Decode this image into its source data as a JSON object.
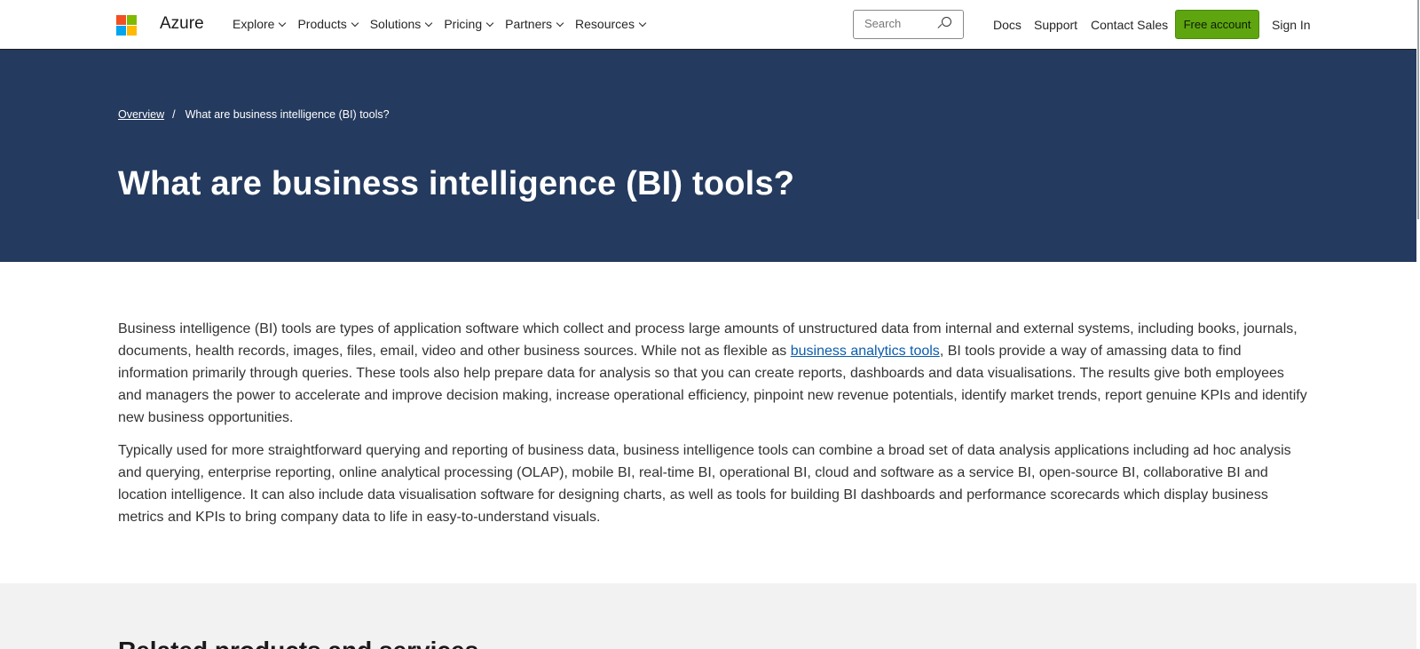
{
  "header": {
    "brand": "Azure",
    "logo_colors": [
      "#f25022",
      "#7fba00",
      "#00a4ef",
      "#ffb900"
    ],
    "nav": [
      {
        "label": "Explore"
      },
      {
        "label": "Products"
      },
      {
        "label": "Solutions"
      },
      {
        "label": "Pricing"
      },
      {
        "label": "Partners"
      },
      {
        "label": "Resources"
      }
    ],
    "search_placeholder": "Search",
    "docs": "Docs",
    "support": "Support",
    "contact_sales": "Contact Sales",
    "free_account": "Free account",
    "sign_in": "Sign In"
  },
  "hero": {
    "breadcrumb_overview": "Overview",
    "breadcrumb_separator": "/",
    "breadcrumb_current": "What are business intelligence (BI) tools?",
    "title": "What are business intelligence (BI) tools?",
    "background": "#243a5e"
  },
  "body": {
    "p1_before_link": "Business intelligence (BI) tools are types of application software which collect and process large amounts of unstructured data from internal and external systems, including books, journals, documents, health records, images, files, email, video and other business sources. While not as flexible as ",
    "p1_link": "business analytics tools",
    "p1_after_link": ", BI tools provide a way of amassing data to find information primarily through queries. These tools also help prepare data for analysis so that you can create reports, dashboards and data visualisations. The results give both employees and managers the power to accelerate and improve decision making, increase operational efficiency, pinpoint new revenue potentials, identify market trends, report genuine KPIs and identify new business opportunities.",
    "p2": "Typically used for more straightforward querying and reporting of business data, business intelligence tools can combine a broad set of data analysis applications including ad hoc analysis and querying, enterprise reporting, online analytical processing (OLAP), mobile BI, real-time BI, operational BI, cloud and software as a service BI, open-source BI, collaborative BI and location intelligence. It can also include data visualisation software for designing charts, as well as tools for building BI dashboards and performance scorecards which display business metrics and KPIs to bring company data to life in easy-to-understand visuals."
  },
  "related": {
    "heading": "Related products and services"
  },
  "colors": {
    "accent_green": "#5ea50f",
    "link_blue": "#0b5cad"
  }
}
